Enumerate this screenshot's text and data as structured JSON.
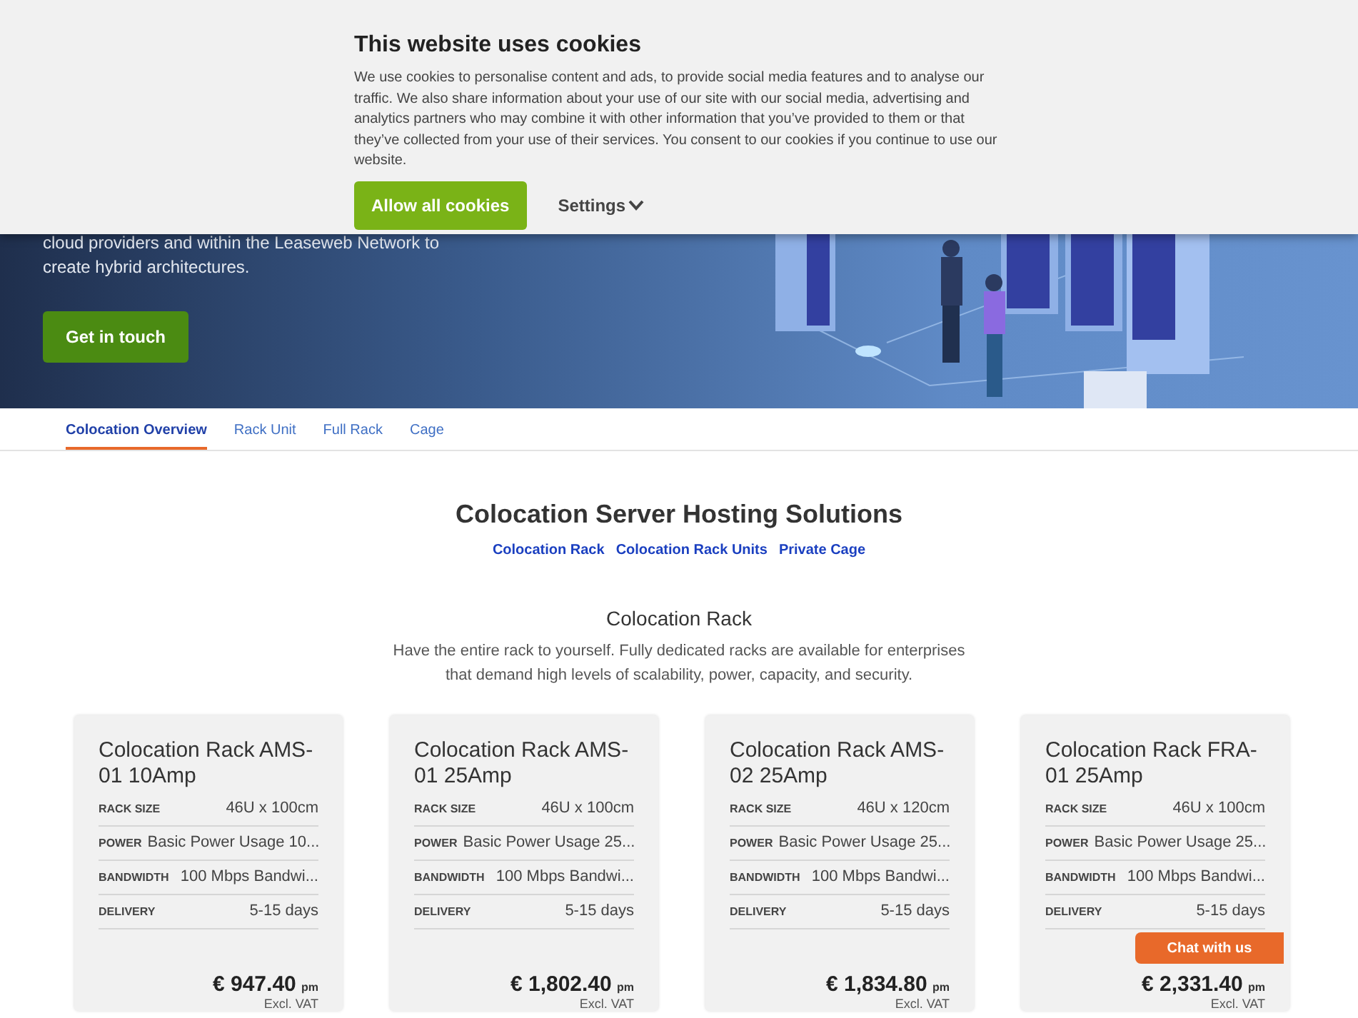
{
  "cookie_banner": {
    "title": "This website uses cookies",
    "text": "We use cookies to personalise content and ads, to provide social media features and to analyse our traffic. We also share information about your use of our site with our social media, advertising and analytics partners who may combine it with other information that you’ve provided to them or that they’ve collected from your use of their services. You consent to our cookies if you continue to use our website.",
    "allow_button": "Allow all cookies",
    "settings_link": "Settings",
    "settings_expanded": false
  },
  "hero": {
    "text_lines": [
      "cloud providers and within the Leaseweb Network to",
      "create hybrid architectures."
    ],
    "button": "Get in touch"
  },
  "tabs": [
    {
      "label": "Colocation Overview",
      "selected": true
    },
    {
      "label": "Rack Unit",
      "selected": false
    },
    {
      "label": "Full Rack",
      "selected": false
    },
    {
      "label": "Cage",
      "selected": false
    }
  ],
  "section": {
    "title": "Colocation Server Hosting Solutions",
    "links": [
      "Colocation Rack",
      "Colocation Rack Units",
      "Private Cage"
    ]
  },
  "subsection": {
    "title": "Colocation Rack",
    "description": "Have the entire rack to yourself. Fully dedicated racks are available for enterprises that demand high levels of scalability, power, capacity, and security."
  },
  "cards": [
    {
      "title": "Colocation Rack AMS-01 10Amp",
      "specs": [
        {
          "label": "RACK SIZE",
          "value": "46U x 100cm"
        },
        {
          "label": "POWER",
          "value": "Basic Power Usage 10..."
        },
        {
          "label": "BANDWIDTH",
          "value": "100 Mbps Bandwi..."
        },
        {
          "label": "DELIVERY",
          "value": "5-15 days"
        }
      ],
      "price": "€ 947.40",
      "period": "pm",
      "note": "Excl. VAT"
    },
    {
      "title": "Colocation Rack AMS-01 25Amp",
      "specs": [
        {
          "label": "RACK SIZE",
          "value": "46U x 100cm"
        },
        {
          "label": "POWER",
          "value": "Basic Power Usage 25..."
        },
        {
          "label": "BANDWIDTH",
          "value": "100 Mbps Bandwi..."
        },
        {
          "label": "DELIVERY",
          "value": "5-15 days"
        }
      ],
      "price": "€ 1,802.40",
      "period": "pm",
      "note": "Excl. VAT"
    },
    {
      "title": "Colocation Rack AMS-02 25Amp",
      "specs": [
        {
          "label": "RACK SIZE",
          "value": "46U x 120cm"
        },
        {
          "label": "POWER",
          "value": "Basic Power Usage 25..."
        },
        {
          "label": "BANDWIDTH",
          "value": "100 Mbps Bandwi..."
        },
        {
          "label": "DELIVERY",
          "value": "5-15 days"
        }
      ],
      "price": "€ 1,834.80",
      "period": "pm",
      "note": "Excl. VAT"
    },
    {
      "title": "Colocation Rack FRA-01 25Amp",
      "specs": [
        {
          "label": "RACK SIZE",
          "value": "46U x 100cm"
        },
        {
          "label": "POWER",
          "value": "Basic Power Usage 25..."
        },
        {
          "label": "BANDWIDTH",
          "value": "100 Mbps Bandwi..."
        },
        {
          "label": "DELIVERY",
          "value": "5-15 days"
        }
      ],
      "price": "€ 2,331.40",
      "period": "pm",
      "note": "Excl. VAT"
    }
  ],
  "chat_button": "Chat with us"
}
